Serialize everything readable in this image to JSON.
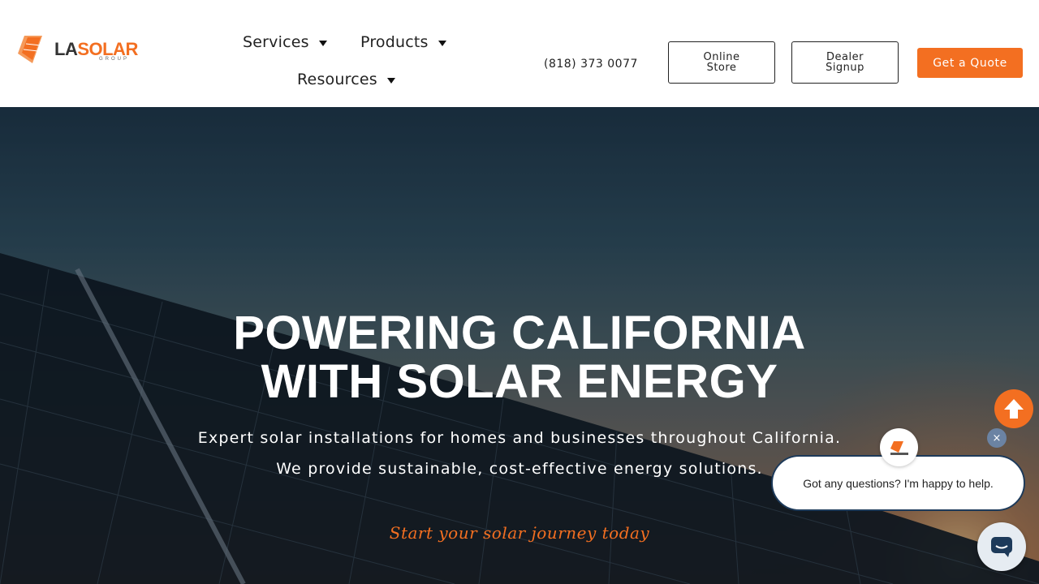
{
  "brand": {
    "logo_la": "LA",
    "logo_solar": "SOLAR",
    "logo_sub": "GROUP",
    "accent": "#f36f21",
    "navy": "#1d3a5a"
  },
  "nav": {
    "services": "Services",
    "products": "Products",
    "resources": "Resources"
  },
  "header": {
    "phone": "(818) 373 0077",
    "online_store": "Online\nStore",
    "dealer_signup": "Dealer\nSignup",
    "get_quote": "Get a Quote"
  },
  "hero": {
    "title_line1": "POWERING CALIFORNIA",
    "title_line2": "WITH SOLAR ENERGY",
    "sub_line1": "Expert solar installations for homes and businesses throughout California.",
    "sub_line2": "We provide sustainable, cost-effective energy solutions.",
    "cta": "Start your solar journey today"
  },
  "chat": {
    "message": "Got any questions? I'm happy to help.",
    "close_label": "×",
    "icons": [
      "arrow-up-icon",
      "chat-icon",
      "close-icon"
    ]
  }
}
